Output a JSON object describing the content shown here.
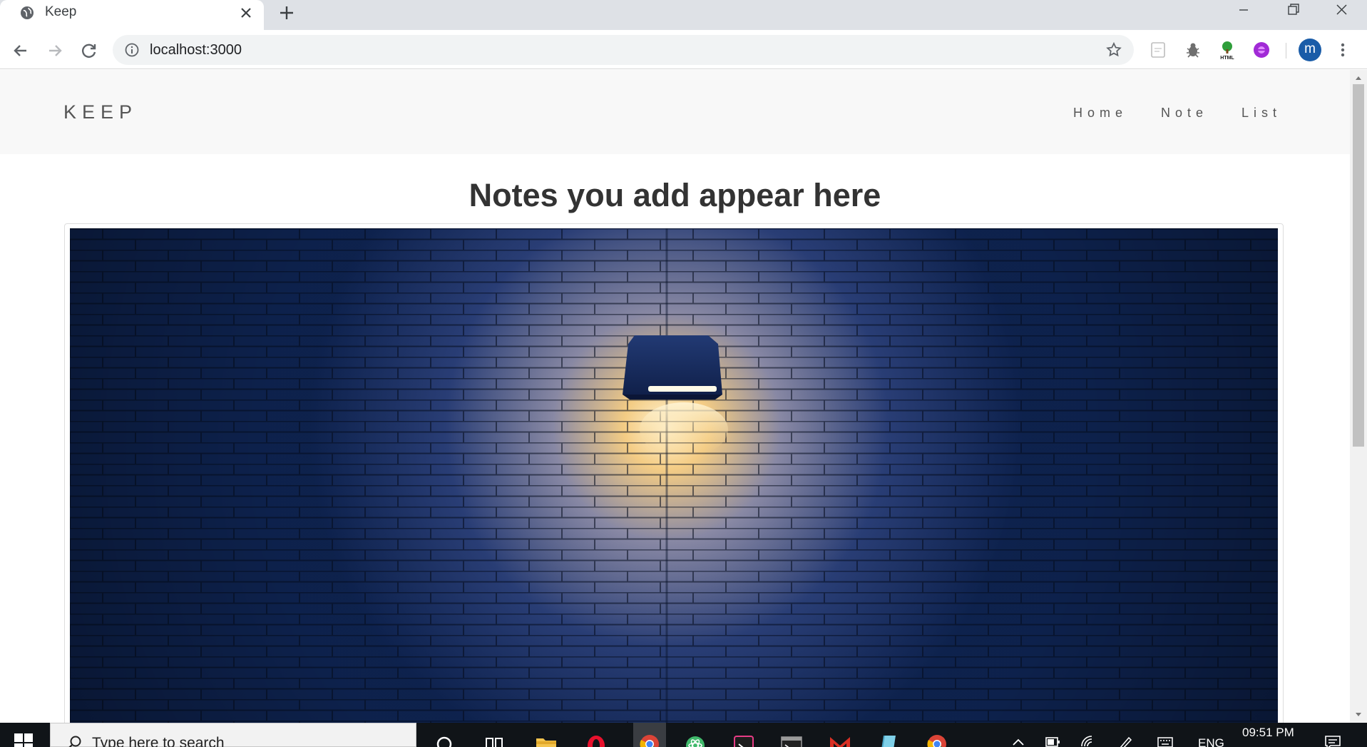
{
  "browser": {
    "tab_title": "Keep",
    "url": "localhost:3000",
    "profile_initial": "m"
  },
  "app": {
    "brand": "KEEP",
    "nav": {
      "home": "Home",
      "note": "Note",
      "list": "List"
    },
    "heading": "Notes you add appear here",
    "hero_image": "dark-blue-brick-wall-with-lamp"
  },
  "taskbar": {
    "search_placeholder": "Type here to search",
    "language": "ENG",
    "time": "09:51 PM"
  },
  "colors": {
    "brick_dark": "#0e2350",
    "brick_light": "#f3c46b",
    "navbar_bg": "#f8f8f8",
    "taskbar_bg": "#101418",
    "avatar": "#1a5ca8"
  }
}
